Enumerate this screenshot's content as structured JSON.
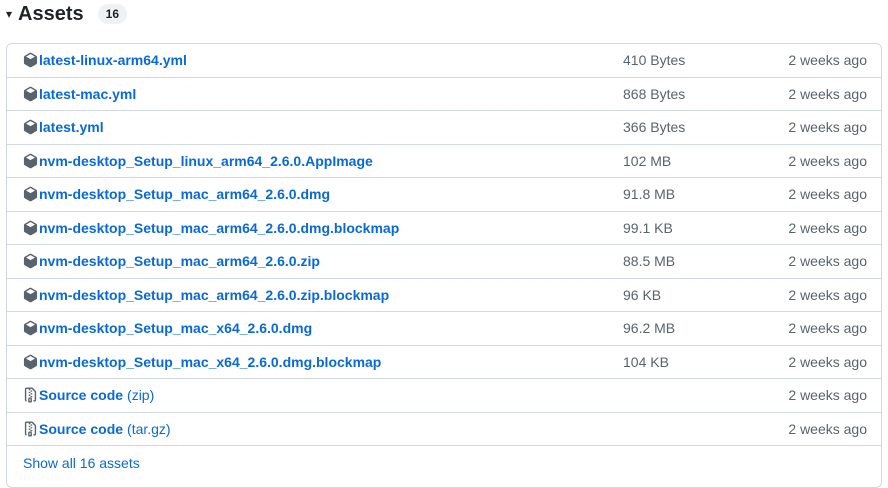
{
  "header": {
    "caret": "▾",
    "title": "Assets",
    "count": "16"
  },
  "assets": [
    {
      "name": "latest-linux-arm64.yml",
      "size": "410 Bytes",
      "date": "2 weeks ago",
      "icon": "package-icon"
    },
    {
      "name": "latest-mac.yml",
      "size": "868 Bytes",
      "date": "2 weeks ago",
      "icon": "package-icon"
    },
    {
      "name": "latest.yml",
      "size": "366 Bytes",
      "date": "2 weeks ago",
      "icon": "package-icon"
    },
    {
      "name": "nvm-desktop_Setup_linux_arm64_2.6.0.AppImage",
      "size": "102 MB",
      "date": "2 weeks ago",
      "icon": "package-icon"
    },
    {
      "name": "nvm-desktop_Setup_mac_arm64_2.6.0.dmg",
      "size": "91.8 MB",
      "date": "2 weeks ago",
      "icon": "package-icon"
    },
    {
      "name": "nvm-desktop_Setup_mac_arm64_2.6.0.dmg.blockmap",
      "size": "99.1 KB",
      "date": "2 weeks ago",
      "icon": "package-icon"
    },
    {
      "name": "nvm-desktop_Setup_mac_arm64_2.6.0.zip",
      "size": "88.5 MB",
      "date": "2 weeks ago",
      "icon": "package-icon"
    },
    {
      "name": "nvm-desktop_Setup_mac_arm64_2.6.0.zip.blockmap",
      "size": "96 KB",
      "date": "2 weeks ago",
      "icon": "package-icon"
    },
    {
      "name": "nvm-desktop_Setup_mac_x64_2.6.0.dmg",
      "size": "96.2 MB",
      "date": "2 weeks ago",
      "icon": "package-icon"
    },
    {
      "name": "nvm-desktop_Setup_mac_x64_2.6.0.dmg.blockmap",
      "size": "104 KB",
      "date": "2 weeks ago",
      "icon": "package-icon"
    },
    {
      "name": "Source code",
      "suffix": "(zip)",
      "size": "",
      "date": "2 weeks ago",
      "icon": "file-zip-icon"
    },
    {
      "name": "Source code",
      "suffix": "(tar.gz)",
      "size": "",
      "date": "2 weeks ago",
      "icon": "file-zip-icon"
    }
  ],
  "footer": {
    "show_all": "Show all 16 assets"
  },
  "colors": {
    "link": "#0969da",
    "muted": "#59636e",
    "border": "#d1d9e0"
  }
}
